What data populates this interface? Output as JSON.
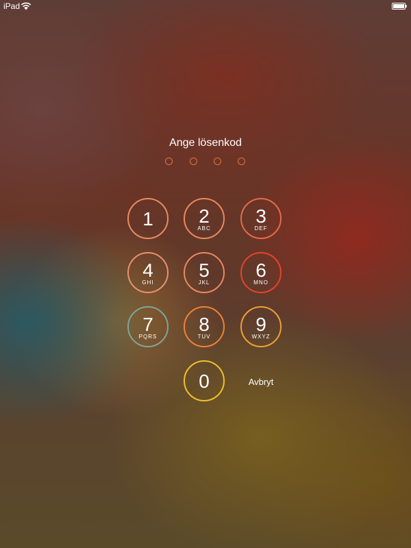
{
  "status_bar": {
    "carrier": "iPad",
    "wifi_icon": "wifi-icon",
    "battery_icon": "battery-icon",
    "battery_level": 1.0
  },
  "passcode": {
    "title": "Ange lösenkod",
    "entered_count": 0,
    "total_digits": 4
  },
  "keypad": {
    "keys": [
      {
        "digit": "1",
        "letters": "",
        "color": "#ec8a62"
      },
      {
        "digit": "2",
        "letters": "ABC",
        "color": "#ec8762"
      },
      {
        "digit": "3",
        "letters": "DEF",
        "color": "#ea6a48"
      },
      {
        "digit": "4",
        "letters": "GHI",
        "color": "#ec9070"
      },
      {
        "digit": "5",
        "letters": "JKL",
        "color": "#ec8862"
      },
      {
        "digit": "6",
        "letters": "MNO",
        "color": "#e8432c"
      },
      {
        "digit": "7",
        "letters": "PQRS",
        "color": "#7fa59b"
      },
      {
        "digit": "8",
        "letters": "TUV",
        "color": "#ec8438"
      },
      {
        "digit": "9",
        "letters": "WXYZ",
        "color": "#f0a034"
      },
      {
        "digit": "0",
        "letters": "",
        "color": "#f2c02e"
      }
    ],
    "cancel_label": "Avbryt"
  }
}
